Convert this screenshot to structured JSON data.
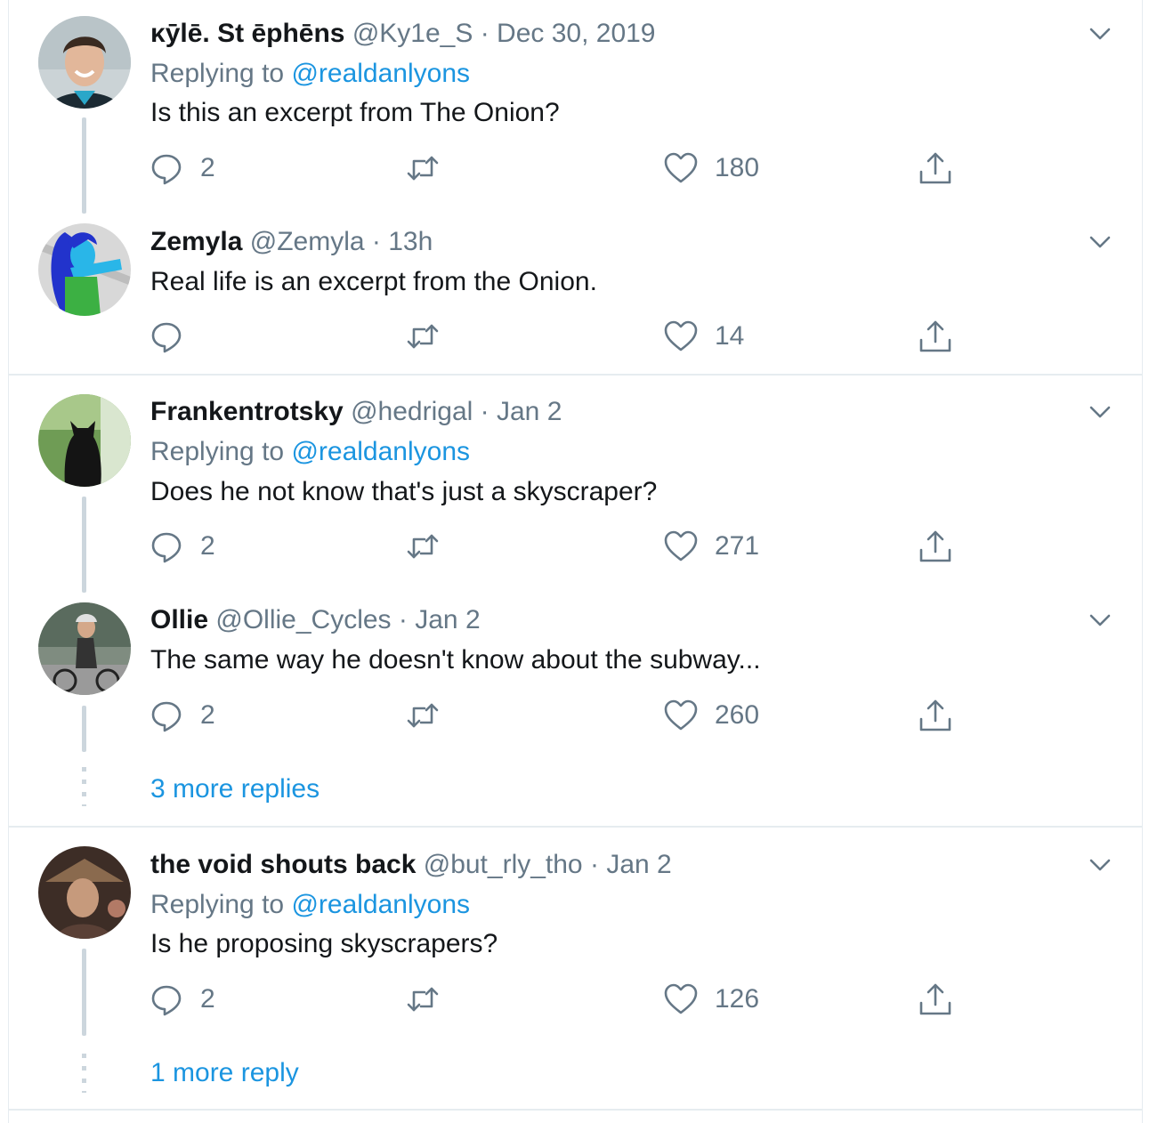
{
  "colors": {
    "accent": "#1b95e0",
    "muted": "#657786",
    "text": "#14171a",
    "divider": "#e6ecf0",
    "thread": "#ccd6dd"
  },
  "icons": {
    "reply": "reply-icon",
    "retweet": "retweet-icon",
    "like": "heart-icon",
    "share": "share-icon",
    "menu": "chevron-down-icon"
  },
  "tweets": [
    {
      "name": "κӯlē. St ēphēns",
      "handle": "@Ky1e_S",
      "sep": "·",
      "time": "Dec 30, 2019",
      "replying_prefix": "Replying to",
      "replying_to": "@realdanlyons",
      "text": "Is this an excerpt from The Onion?",
      "replies": "2",
      "retweets": "",
      "likes": "180"
    },
    {
      "name": "Zemyla",
      "handle": "@Zemyla",
      "sep": "·",
      "time": "13h",
      "text": "Real life is an excerpt from the Onion.",
      "replies": "",
      "retweets": "",
      "likes": "14"
    },
    {
      "name": "Frankentrotsky",
      "handle": "@hedrigal",
      "sep": "·",
      "time": "Jan 2",
      "replying_prefix": "Replying to",
      "replying_to": "@realdanlyons",
      "text": "Does he not know that's just a skyscraper?",
      "replies": "2",
      "retweets": "",
      "likes": "271"
    },
    {
      "name": "Ollie",
      "handle": "@Ollie_Cycles",
      "sep": "·",
      "time": "Jan 2",
      "text": "The same way he doesn't know about the subway...",
      "replies": "2",
      "retweets": "",
      "likes": "260"
    },
    {
      "name": "the void shouts back",
      "handle": "@but_rly_tho",
      "sep": "·",
      "time": "Jan 2",
      "replying_prefix": "Replying to",
      "replying_to": "@realdanlyons",
      "text": "Is he proposing skyscrapers?",
      "replies": "2",
      "retweets": "",
      "likes": "126"
    }
  ],
  "more_links": [
    "3 more replies",
    "1 more reply"
  ]
}
